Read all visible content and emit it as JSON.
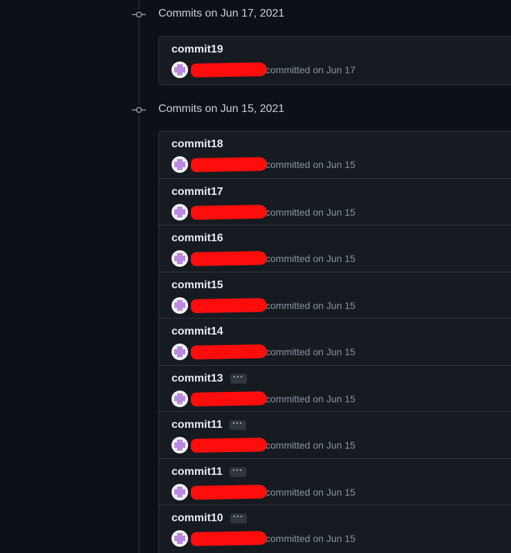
{
  "groups": [
    {
      "title": "Commits on Jun 17, 2021",
      "commits": [
        {
          "title": "commit19",
          "has_ellipsis": false,
          "meta": "committed on Jun 17"
        }
      ]
    },
    {
      "title": "Commits on Jun 15, 2021",
      "commits": [
        {
          "title": "commit18",
          "has_ellipsis": false,
          "meta": "committed on Jun 15"
        },
        {
          "title": "commit17",
          "has_ellipsis": false,
          "meta": "committed on Jun 15"
        },
        {
          "title": "commit16",
          "has_ellipsis": false,
          "meta": "committed on Jun 15"
        },
        {
          "title": "commit15",
          "has_ellipsis": false,
          "meta": "committed on Jun 15"
        },
        {
          "title": "commit14",
          "has_ellipsis": false,
          "meta": "committed on Jun 15"
        },
        {
          "title": "commit13",
          "has_ellipsis": true,
          "meta": "committed on Jun 15"
        },
        {
          "title": "commit11",
          "has_ellipsis": true,
          "meta": "committed on Jun 15"
        },
        {
          "title": "commit11",
          "has_ellipsis": true,
          "meta": "committed on Jun 15"
        },
        {
          "title": "commit10",
          "has_ellipsis": true,
          "meta": "committed on Jun 15"
        }
      ]
    }
  ],
  "ellipsis_label": "···",
  "colors": {
    "background": "#0d1117",
    "box": "#161b22",
    "border": "#30363d",
    "redaction": "#ff0d0d",
    "avatar": "#b98be0"
  },
  "icons": {
    "timeline_node": "git-commit-icon",
    "avatar": "identicon-avatar"
  }
}
